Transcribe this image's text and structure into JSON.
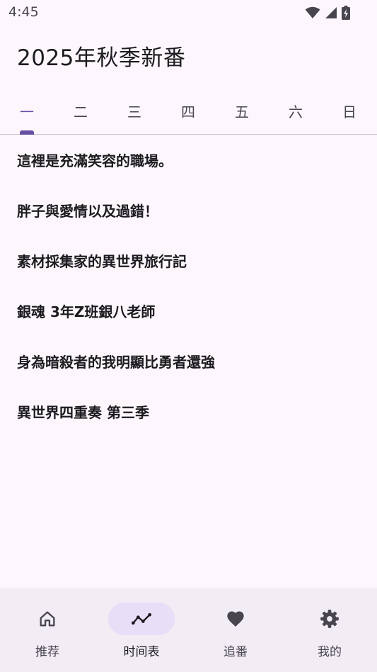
{
  "status_bar": {
    "time": "4:45"
  },
  "header": {
    "title": "2025年秋季新番"
  },
  "weekday_tabs": [
    {
      "label": "一",
      "active": true
    },
    {
      "label": "二",
      "active": false
    },
    {
      "label": "三",
      "active": false
    },
    {
      "label": "四",
      "active": false
    },
    {
      "label": "五",
      "active": false
    },
    {
      "label": "六",
      "active": false
    },
    {
      "label": "日",
      "active": false
    }
  ],
  "shows": [
    "這裡是充滿笑容的職場。",
    "胖子與愛情以及過錯！",
    "素材採集家的異世界旅行記",
    "銀魂 3年Z班銀八老師",
    "身為暗殺者的我明顯比勇者還強",
    "異世界四重奏 第三季"
  ],
  "bottom_nav": [
    {
      "label": "推荐",
      "icon": "home-icon",
      "active": false
    },
    {
      "label": "时间表",
      "icon": "timeline-icon",
      "active": true
    },
    {
      "label": "追番",
      "icon": "heart-icon",
      "active": false
    },
    {
      "label": "我的",
      "icon": "gear-icon",
      "active": false
    }
  ],
  "colors": {
    "background": "#fdf7fd",
    "accent": "#6750a4",
    "nav_background": "#f2ecf4",
    "active_pill": "#e8def8"
  }
}
